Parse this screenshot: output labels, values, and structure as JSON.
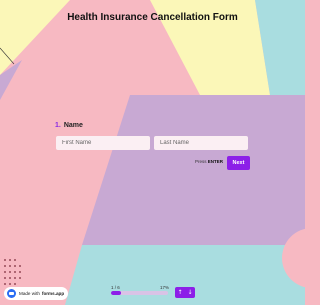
{
  "form": {
    "title": "Health Insurance Cancellation Form",
    "question_number": "1.",
    "question_label": "Name",
    "first_name_placeholder": "First Name",
    "last_name_placeholder": "Last Name",
    "first_name_value": "",
    "last_name_value": ""
  },
  "actions": {
    "press_prefix": "Press",
    "press_key": "ENTER",
    "next_label": "Next"
  },
  "progress": {
    "count_text": "1 / 6",
    "percent_text": "17%",
    "fraction": 0.17
  },
  "navigation": {
    "up_icon": "arrow-up-icon",
    "down_icon": "arrow-down-icon"
  },
  "branding": {
    "made_with": "Made with",
    "brand": "forms.app"
  },
  "colors": {
    "accent": "#8c1fe8",
    "bg_pink": "#f7b9c2",
    "bg_yellow": "#fbf7b8",
    "bg_cyan": "#a9dde0",
    "bg_lavender": "#c8a9d3"
  }
}
